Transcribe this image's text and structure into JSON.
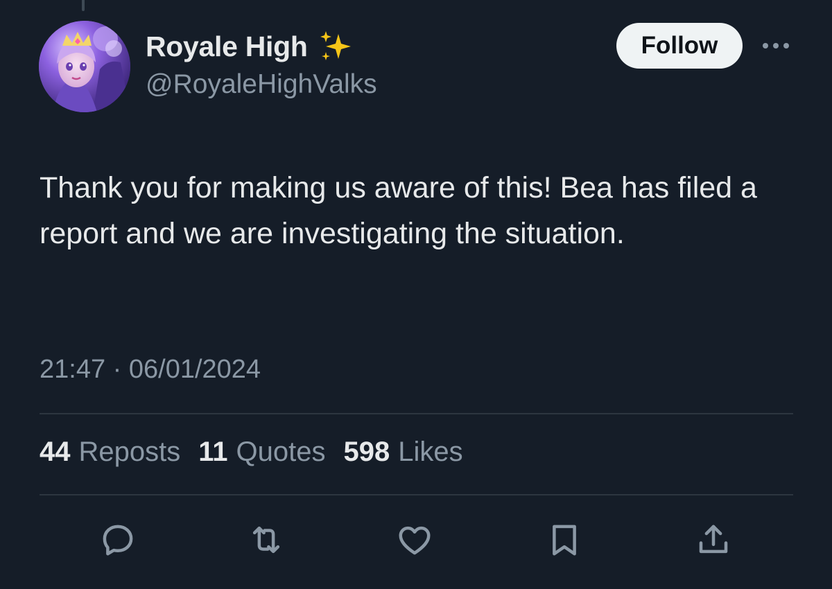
{
  "author": {
    "display_name": "Royale High",
    "handle": "@RoyaleHighValks",
    "avatar": "avatar-image"
  },
  "follow_label": "Follow",
  "tweet": {
    "text": "Thank you for making us aware of this! Bea has filed a report and we are investigating the situation.",
    "timestamp": "21:47 · 06/01/2024"
  },
  "stats": {
    "reposts": {
      "count": "44",
      "label": "Reposts"
    },
    "quotes": {
      "count": "11",
      "label": "Quotes"
    },
    "likes": {
      "count": "598",
      "label": "Likes"
    }
  },
  "icons": [
    "sparkles-icon",
    "more-icon",
    "reply-icon",
    "repost-icon",
    "like-icon",
    "bookmark-icon",
    "share-icon"
  ],
  "colors": {
    "background": "#151d28",
    "text_primary": "#e7e9ea",
    "text_secondary": "#8b98a5",
    "divider": "#2d3640",
    "follow_bg": "#eff3f4",
    "sparkle": "#f5c518"
  }
}
